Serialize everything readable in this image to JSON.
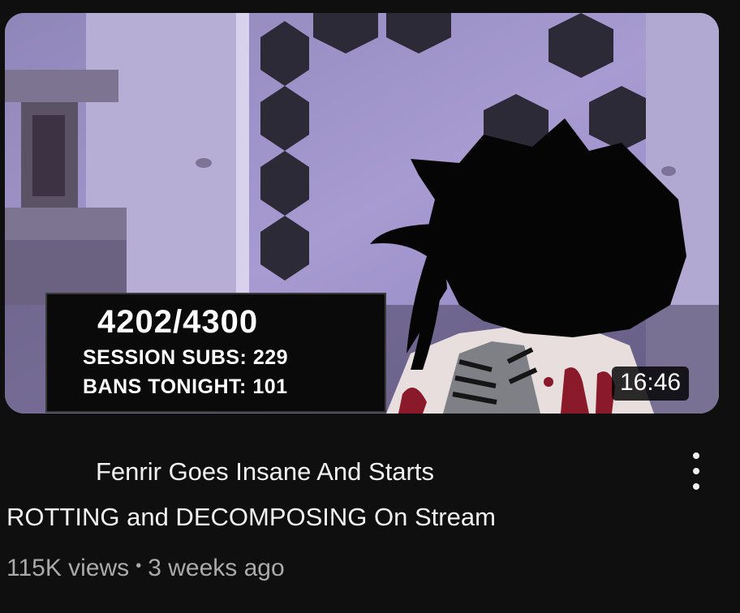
{
  "thumbnail": {
    "stats": {
      "progress": "4202/4300",
      "session_subs": "SESSION SUBS: 229",
      "bans_tonight": "BANS TONIGHT: 101"
    },
    "duration": "16:46"
  },
  "video": {
    "title_line1": "Fenrir Goes Insane And Starts",
    "title_line2": "ROTTING and DECOMPOSING On Stream",
    "views": "115K views",
    "separator": "•",
    "age": "3 weeks ago"
  },
  "menu": {
    "icon": "more-vertical-icon"
  },
  "colors": {
    "background": "#0f0f0f",
    "title_text": "#f1f1f1",
    "meta_text": "#aaaaaa",
    "wall": "#9b8fc4",
    "blood": "#8a1a2a"
  }
}
